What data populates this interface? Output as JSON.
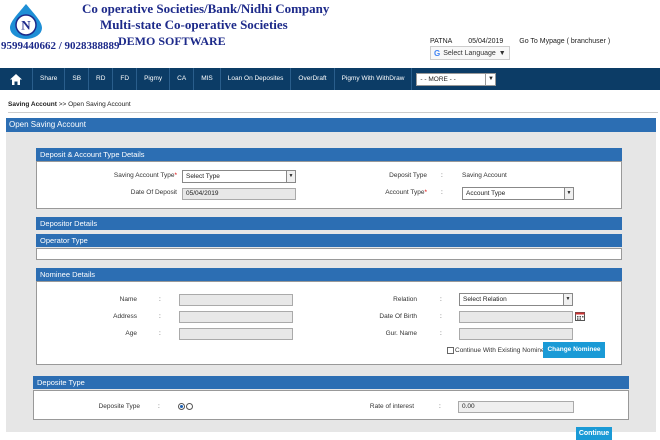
{
  "header": {
    "company_line1": "Co operative Societies/Bank/Nidhi Company",
    "company_line2": "Multi-state Co-operative Societies",
    "company_line3": "DEMO SOFTWARE",
    "phone": "9599440662  / 9028388889",
    "logo_letter": "N",
    "branch": "PATNA",
    "date": "05/04/2019",
    "user_link": "Go To Mypage ( branchuser )",
    "language_label": "Select Language",
    "language_caret": "▼",
    "google_g": "G"
  },
  "nav": {
    "items": [
      "Share",
      "SB",
      "RD",
      "FD",
      "Pigmy",
      "CA",
      "MIS",
      "Loan On Deposites",
      "OverDraft",
      "Pigmy With WithDraw"
    ],
    "more_select": "- - MORE - -"
  },
  "breadcrumb": {
    "root": "Saving Account",
    "sep": " >> ",
    "current": "Open Saving Account"
  },
  "page_title": "Open Saving Account",
  "sections": {
    "deposit_account": "Deposit & Account Type Details",
    "depositor": "Depositor Details",
    "operator": "Operator Type",
    "nominee": "Nominee Details",
    "deposite_type": "Deposite Type"
  },
  "deposit_form": {
    "saving_account_type_label": "Saving Account Type",
    "saving_account_type_value": "Select Type",
    "date_of_deposit_label": "Date Of Deposit",
    "date_of_deposit_value": "05/04/2019",
    "deposit_type_label": "Deposit Type",
    "deposit_type_value": "Saving Account",
    "account_type_label": "Account Type",
    "account_type_value": "Account Type",
    "required_mark": "*",
    "colon": ":"
  },
  "nominee_form": {
    "name_label": "Name",
    "address_label": "Address",
    "age_label": "Age",
    "relation_label": "Relation",
    "relation_value": "Select Relation",
    "dob_label": "Date Of Birth",
    "gur_name_label": "Gur. Name",
    "existing_checkbox_label": "Continue With Existing Nominee",
    "change_nominee_button": "Change Nominee"
  },
  "deposite_form": {
    "deposite_type_label": "Deposite Type",
    "rate_label": "Rate of interest",
    "rate_value": "0.00"
  },
  "continue_button": "Continue",
  "colors": {
    "nav_bg": "#0c3c66",
    "section_bar": "#2c6eb3",
    "button": "#1a9ad6",
    "brand_text": "#1d2a8a"
  }
}
